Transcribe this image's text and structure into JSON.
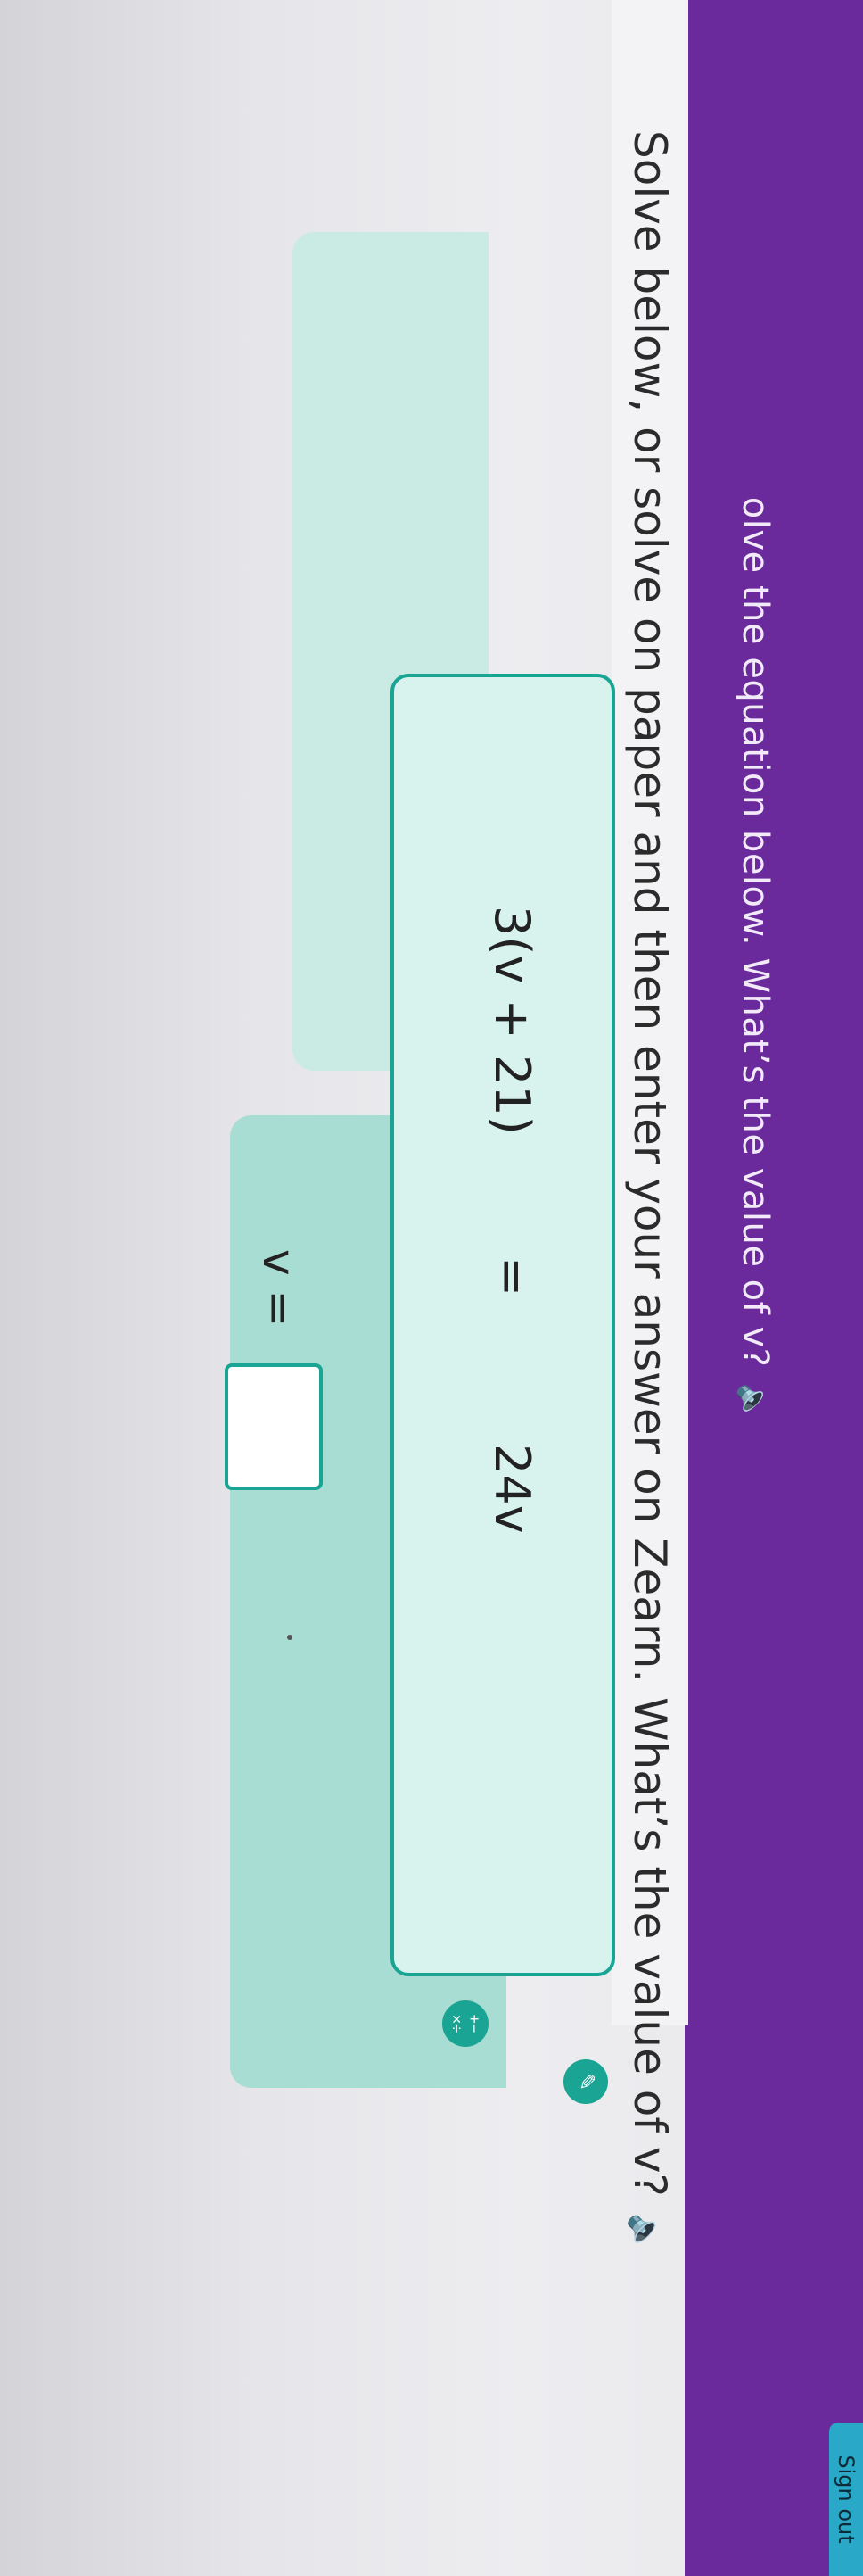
{
  "header": {
    "title": "olve the equation below. What’s the value of v?",
    "sign_out_label": "Sign out",
    "audio_icon": "speaker-icon"
  },
  "instructions": {
    "text": "Solve below, or solve on paper and then enter your answer on Zearn. What’s the value of v?",
    "audio_icon": "speaker-icon"
  },
  "equation": {
    "left": "3(v + 21)",
    "sign": "=",
    "right": "24v"
  },
  "answer": {
    "label": "v =",
    "value": ""
  },
  "tools": {
    "calculator_icon": "calculator-icon",
    "pencil_icon": "pencil-icon"
  },
  "colors": {
    "banner": "#6a2a9c",
    "accent": "#1aa493",
    "card": "#d8f3ee",
    "sign_out": "#2aa8c8"
  }
}
